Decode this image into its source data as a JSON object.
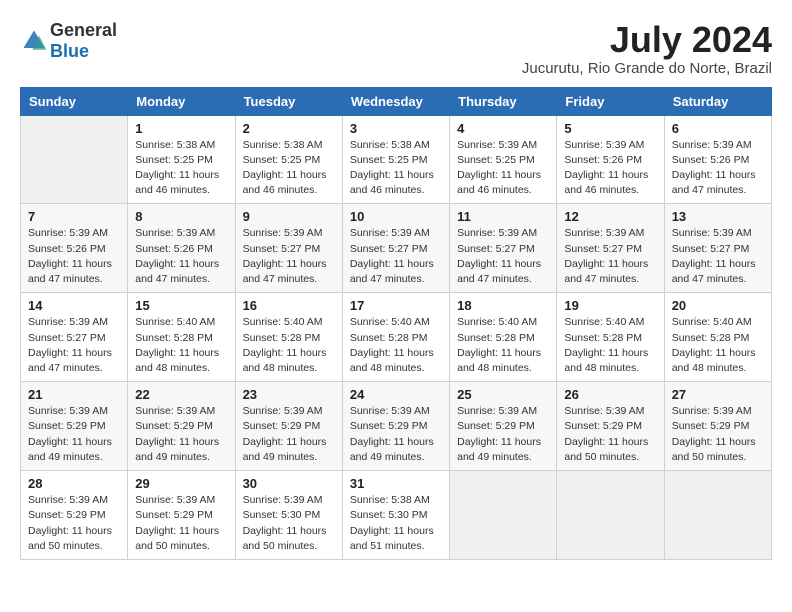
{
  "header": {
    "logo": {
      "text_general": "General",
      "text_blue": "Blue"
    },
    "title": "July 2024",
    "location": "Jucurutu, Rio Grande do Norte, Brazil"
  },
  "weekdays": [
    "Sunday",
    "Monday",
    "Tuesday",
    "Wednesday",
    "Thursday",
    "Friday",
    "Saturday"
  ],
  "weeks": [
    [
      {
        "day": "",
        "info": ""
      },
      {
        "day": "1",
        "info": "Sunrise: 5:38 AM\nSunset: 5:25 PM\nDaylight: 11 hours\nand 46 minutes."
      },
      {
        "day": "2",
        "info": "Sunrise: 5:38 AM\nSunset: 5:25 PM\nDaylight: 11 hours\nand 46 minutes."
      },
      {
        "day": "3",
        "info": "Sunrise: 5:38 AM\nSunset: 5:25 PM\nDaylight: 11 hours\nand 46 minutes."
      },
      {
        "day": "4",
        "info": "Sunrise: 5:39 AM\nSunset: 5:25 PM\nDaylight: 11 hours\nand 46 minutes."
      },
      {
        "day": "5",
        "info": "Sunrise: 5:39 AM\nSunset: 5:26 PM\nDaylight: 11 hours\nand 46 minutes."
      },
      {
        "day": "6",
        "info": "Sunrise: 5:39 AM\nSunset: 5:26 PM\nDaylight: 11 hours\nand 47 minutes."
      }
    ],
    [
      {
        "day": "7",
        "info": "Sunrise: 5:39 AM\nSunset: 5:26 PM\nDaylight: 11 hours\nand 47 minutes."
      },
      {
        "day": "8",
        "info": "Sunrise: 5:39 AM\nSunset: 5:26 PM\nDaylight: 11 hours\nand 47 minutes."
      },
      {
        "day": "9",
        "info": "Sunrise: 5:39 AM\nSunset: 5:27 PM\nDaylight: 11 hours\nand 47 minutes."
      },
      {
        "day": "10",
        "info": "Sunrise: 5:39 AM\nSunset: 5:27 PM\nDaylight: 11 hours\nand 47 minutes."
      },
      {
        "day": "11",
        "info": "Sunrise: 5:39 AM\nSunset: 5:27 PM\nDaylight: 11 hours\nand 47 minutes."
      },
      {
        "day": "12",
        "info": "Sunrise: 5:39 AM\nSunset: 5:27 PM\nDaylight: 11 hours\nand 47 minutes."
      },
      {
        "day": "13",
        "info": "Sunrise: 5:39 AM\nSunset: 5:27 PM\nDaylight: 11 hours\nand 47 minutes."
      }
    ],
    [
      {
        "day": "14",
        "info": "Sunrise: 5:39 AM\nSunset: 5:27 PM\nDaylight: 11 hours\nand 47 minutes."
      },
      {
        "day": "15",
        "info": "Sunrise: 5:40 AM\nSunset: 5:28 PM\nDaylight: 11 hours\nand 48 minutes."
      },
      {
        "day": "16",
        "info": "Sunrise: 5:40 AM\nSunset: 5:28 PM\nDaylight: 11 hours\nand 48 minutes."
      },
      {
        "day": "17",
        "info": "Sunrise: 5:40 AM\nSunset: 5:28 PM\nDaylight: 11 hours\nand 48 minutes."
      },
      {
        "day": "18",
        "info": "Sunrise: 5:40 AM\nSunset: 5:28 PM\nDaylight: 11 hours\nand 48 minutes."
      },
      {
        "day": "19",
        "info": "Sunrise: 5:40 AM\nSunset: 5:28 PM\nDaylight: 11 hours\nand 48 minutes."
      },
      {
        "day": "20",
        "info": "Sunrise: 5:40 AM\nSunset: 5:28 PM\nDaylight: 11 hours\nand 48 minutes."
      }
    ],
    [
      {
        "day": "21",
        "info": "Sunrise: 5:39 AM\nSunset: 5:29 PM\nDaylight: 11 hours\nand 49 minutes."
      },
      {
        "day": "22",
        "info": "Sunrise: 5:39 AM\nSunset: 5:29 PM\nDaylight: 11 hours\nand 49 minutes."
      },
      {
        "day": "23",
        "info": "Sunrise: 5:39 AM\nSunset: 5:29 PM\nDaylight: 11 hours\nand 49 minutes."
      },
      {
        "day": "24",
        "info": "Sunrise: 5:39 AM\nSunset: 5:29 PM\nDaylight: 11 hours\nand 49 minutes."
      },
      {
        "day": "25",
        "info": "Sunrise: 5:39 AM\nSunset: 5:29 PM\nDaylight: 11 hours\nand 49 minutes."
      },
      {
        "day": "26",
        "info": "Sunrise: 5:39 AM\nSunset: 5:29 PM\nDaylight: 11 hours\nand 50 minutes."
      },
      {
        "day": "27",
        "info": "Sunrise: 5:39 AM\nSunset: 5:29 PM\nDaylight: 11 hours\nand 50 minutes."
      }
    ],
    [
      {
        "day": "28",
        "info": "Sunrise: 5:39 AM\nSunset: 5:29 PM\nDaylight: 11 hours\nand 50 minutes."
      },
      {
        "day": "29",
        "info": "Sunrise: 5:39 AM\nSunset: 5:29 PM\nDaylight: 11 hours\nand 50 minutes."
      },
      {
        "day": "30",
        "info": "Sunrise: 5:39 AM\nSunset: 5:30 PM\nDaylight: 11 hours\nand 50 minutes."
      },
      {
        "day": "31",
        "info": "Sunrise: 5:38 AM\nSunset: 5:30 PM\nDaylight: 11 hours\nand 51 minutes."
      },
      {
        "day": "",
        "info": ""
      },
      {
        "day": "",
        "info": ""
      },
      {
        "day": "",
        "info": ""
      }
    ]
  ]
}
